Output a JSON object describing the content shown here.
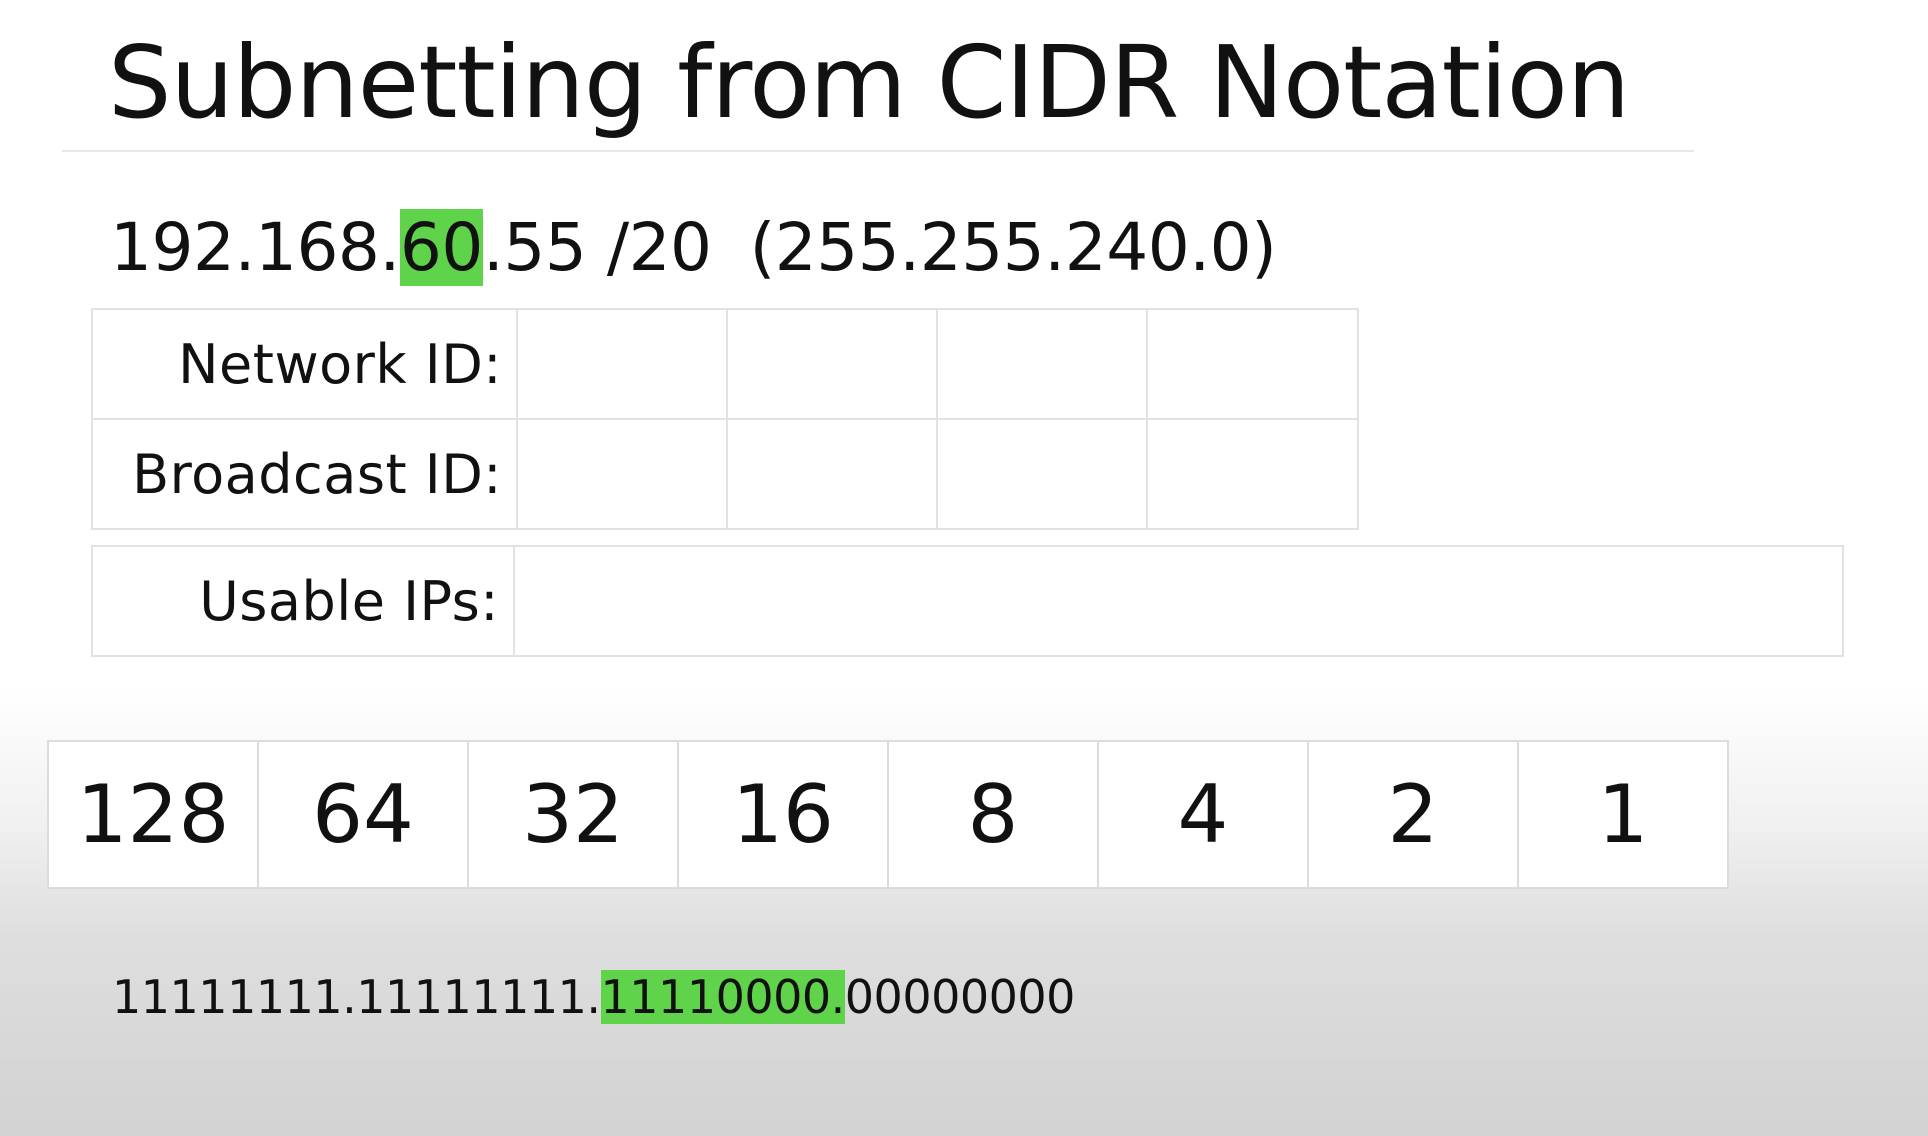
{
  "slide": {
    "title": "Subnetting from CIDR Notation"
  },
  "ip": {
    "prefix": "192.168.",
    "highlighted_octet": "60",
    "suffix": ".55 /20",
    "mask": "(255.255.240.0)"
  },
  "table": {
    "network_label": "Network ID:",
    "broadcast_label": "Broadcast ID:",
    "usable_label": "Usable IPs:"
  },
  "bit_values": [
    "128",
    "64",
    "32",
    "16",
    "8",
    "4",
    "2",
    "1"
  ],
  "binary": {
    "prefix": "11111111.11111111.",
    "highlighted": "11110000.",
    "suffix": "00000000"
  },
  "colors": {
    "highlight": "#5fd44a"
  }
}
